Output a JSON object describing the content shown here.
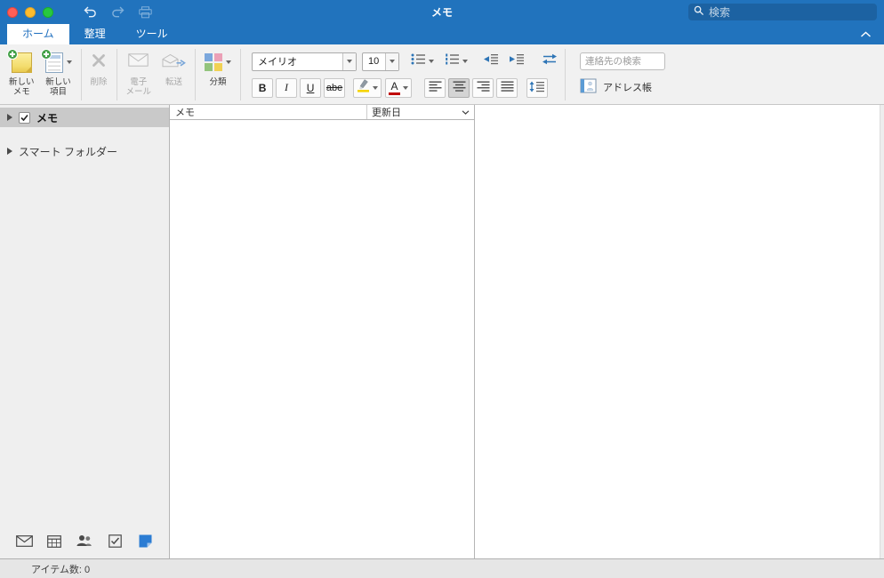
{
  "titlebar": {
    "title": "メモ",
    "search_placeholder": "検索"
  },
  "tabs": {
    "home": "ホーム",
    "organize": "整理",
    "tools": "ツール"
  },
  "ribbon": {
    "new_note_line1": "新しい",
    "new_note_line2": "メモ",
    "new_item_line1": "新しい",
    "new_item_line2": "項目",
    "delete_label": "削除",
    "email_line1": "電子",
    "email_line2": "メール",
    "forward_label": "転送",
    "categorize_label": "分類",
    "font_name": "メイリオ",
    "font_size": "10",
    "bold_label": "B",
    "italic_label": "I",
    "underline_label": "U",
    "strikethrough_label": "abe",
    "font_color_label": "A",
    "contact_search_placeholder": "連絡先の検索",
    "address_book_label": "アドレス帳"
  },
  "sidebar": {
    "notes_label": "メモ",
    "smart_folders_label": "スマート フォルダー"
  },
  "list": {
    "col_notes": "メモ",
    "col_modified": "更新日"
  },
  "statusbar": {
    "item_count": "アイテム数: 0"
  },
  "colors": {
    "titlebar_blue": "#2173bd",
    "active_tab_text": "#1f6fbf",
    "ribbon_bg": "#f1f1f1",
    "selected_row_gray": "#c9c9c9",
    "note_yellow": "#f3dc6d",
    "plus_badge_green": "#43a047",
    "highlight_yellow": "#f6d400",
    "font_color_red": "#c00000",
    "notes_module_blue": "#2b7cd3"
  },
  "icons": {
    "titlebar": [
      "close",
      "minimize",
      "zoom",
      "undo",
      "redo",
      "print",
      "search"
    ],
    "ribbon": [
      "new-note",
      "new-item",
      "delete",
      "email",
      "forward",
      "categorize",
      "chevron-down",
      "bullets",
      "numbering",
      "decrease-indent",
      "increase-indent",
      "text-direction",
      "highlight",
      "font-color",
      "align-left",
      "align-center",
      "align-right",
      "align-justify",
      "line-spacing",
      "address-book"
    ],
    "sidebar": [
      "disclosure-triangle",
      "checkbox",
      "mail",
      "calendar",
      "people",
      "tasks",
      "notes"
    ],
    "list": [
      "sort-chevron-down"
    ]
  }
}
